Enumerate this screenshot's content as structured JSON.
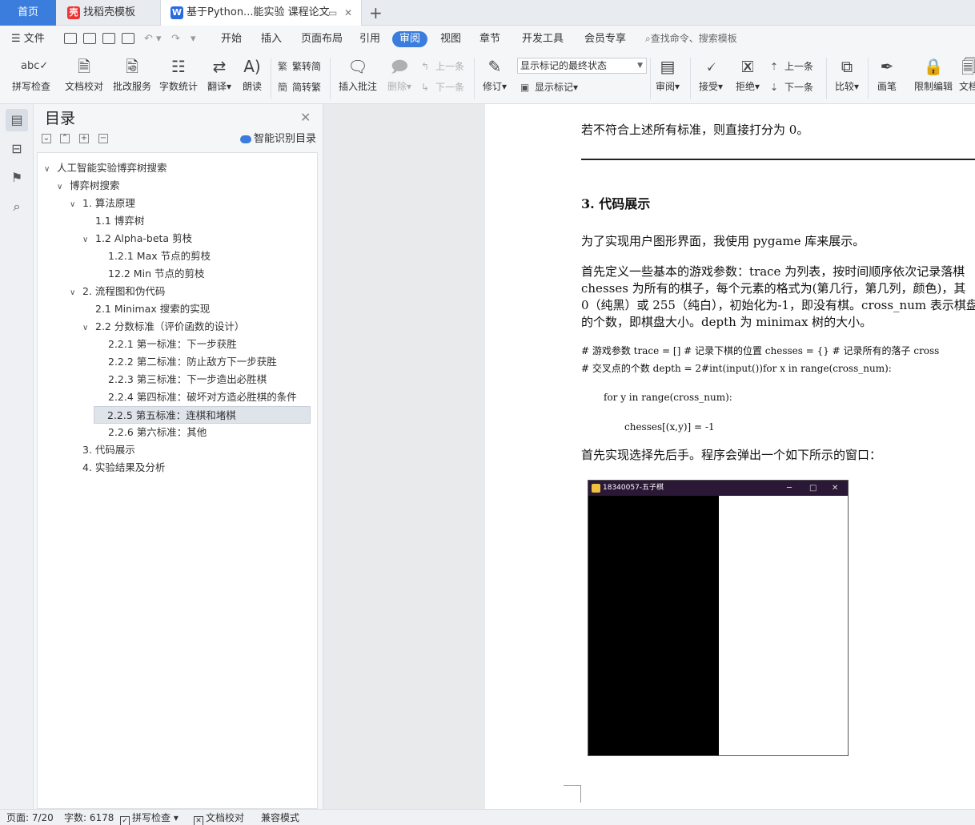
{
  "tabs": {
    "home": "首页",
    "template": "找稻壳模板",
    "document": "基于Python...能实验 课程论文",
    "template_icon": "daoke-icon",
    "document_icon": "wps-writer-icon"
  },
  "menu": {
    "file": "文件",
    "items": [
      "开始",
      "插入",
      "页面布局",
      "引用",
      "审阅",
      "视图",
      "章节",
      "开发工具",
      "会员专享"
    ],
    "active": "审阅",
    "search_placeholder": "查找命令、搜索模板"
  },
  "ribbon": {
    "spell_check": "拼写检查",
    "doc_proof": "文档校对",
    "revise_service": "批改服务",
    "word_count": "字数统计",
    "translate": "翻译",
    "read_aloud": "朗读",
    "trad_to_simp": "繁转简",
    "simp_to_trad": "简转繁",
    "insert_comment": "插入批注",
    "delete": "删除",
    "prev_comment": "上一条",
    "next_comment": "下一条",
    "track_changes": "修订",
    "markup_mode": "显示标记的最终状态",
    "show_markup": "显示标记",
    "review": "审阅",
    "accept": "接受",
    "reject": "拒绝",
    "prev_change": "上一条",
    "next_change": "下一条",
    "compare": "比较",
    "pen": "画笔",
    "restrict_edit": "限制编辑",
    "doc_rights": "文档"
  },
  "toc": {
    "title": "目录",
    "smart_label": "智能识别目录",
    "items": [
      {
        "text": "人工智能实验博弈树搜索",
        "expanded": true,
        "toggle": "∨"
      },
      {
        "text": "博弈树搜索",
        "expanded": true,
        "toggle": "∨"
      },
      {
        "text": "1. 算法原理",
        "expanded": true,
        "toggle": "∨"
      },
      {
        "text": "1.1 博弈树",
        "toggle": ""
      },
      {
        "text": "1.2 Alpha-beta 剪枝",
        "expanded": true,
        "toggle": "∨"
      },
      {
        "text": "1.2.1 Max 节点的剪枝",
        "toggle": ""
      },
      {
        "text": "12.2 Min 节点的剪枝",
        "toggle": ""
      },
      {
        "text": "2. 流程图和伪代码",
        "expanded": true,
        "toggle": "∨"
      },
      {
        "text": "2.1 Minimax 搜索的实现",
        "toggle": ""
      },
      {
        "text": "2.2 分数标准（评价函数的设计）",
        "expanded": true,
        "toggle": "∨"
      },
      {
        "text": "2.2.1  第一标准：下一步获胜",
        "toggle": ""
      },
      {
        "text": "2.2.2  第二标准：防止敌方下一步获胜",
        "toggle": ""
      },
      {
        "text": "2.2.3  第三标准：下一步造出必胜棋",
        "toggle": ""
      },
      {
        "text": "2.2.4  第四标准：破坏对方造必胜棋的条件",
        "toggle": ""
      },
      {
        "text": "2.2.5  第五标准：连棋和堵棋",
        "toggle": "",
        "selected": true
      },
      {
        "text": "2.2.6  第六标准：其他",
        "toggle": ""
      },
      {
        "text": "3. 代码展示",
        "toggle": ""
      },
      {
        "text": "4. 实验结果及分析",
        "toggle": ""
      }
    ]
  },
  "document": {
    "line_top": "若不符合上述所有标准，则直接打分为 0。",
    "heading": "3.  代码展示",
    "para1": "为了实现用户图形界面，我使用 pygame 库来展示。",
    "para2_l1": "首先定义一些基本的游戏参数：trace 为列表，按时间顺序依次记录落棋",
    "para2_l2": "chesses 为所有的棋子，每个元素的格式为(第几行，第几列，颜色)，其",
    "para2_l3": "0（纯黑）或 255（纯白），初始化为-1，即没有棋。cross_num 表示棋盘",
    "para2_l4": "的个数，即棋盘大小。depth 为 minimax 树的大小。",
    "code_l1": "#  游戏参数 trace = []          #  记录下棋的位置 chesses = {}       #  记录所有的落子 cross",
    "code_l2": "#  交叉点的个数 depth = 2#int(input())for x in range(cross_num):",
    "code_l3": "for y in range(cross_num):",
    "code_l4": "chesses[(x,y)] = -1",
    "para3": "首先实现选择先后手。程序会弹出一个如下所示的窗口：",
    "window_title": "18340057-五子棋"
  },
  "status": {
    "page": "页面: 7/20",
    "words": "字数: 6178",
    "spell": "拼写检查",
    "proof": "文档校对",
    "compat": "兼容模式"
  },
  "colors": {
    "accent": "#3b7ddd",
    "window_titlebar": "#2b1736"
  }
}
